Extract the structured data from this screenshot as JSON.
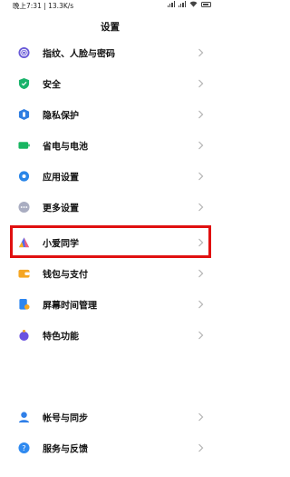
{
  "status_bar": {
    "left_text": "晚上7:31 | 13.3K/s",
    "battery_icon": "battery-icon",
    "wifi_icon": "wifi-icon",
    "signal_icon": "signal-icon"
  },
  "page_title": "设置",
  "groups": [
    {
      "items": [
        {
          "label": "指纹、人脸与密码",
          "icon": "fingerprint-icon",
          "color": "#6a5bd8"
        },
        {
          "label": "安全",
          "icon": "shield-icon",
          "color": "#19b36b"
        },
        {
          "label": "隐私保护",
          "icon": "privacy-icon",
          "color": "#2f7de1"
        },
        {
          "label": "省电与电池",
          "icon": "battery-saver-icon",
          "color": "#18b561"
        },
        {
          "label": "应用设置",
          "icon": "gear-icon",
          "color": "#2a86e8"
        },
        {
          "label": "更多设置",
          "icon": "more-icon",
          "color": "#8c8fa3"
        }
      ]
    },
    {
      "items": [
        {
          "label": "小爱同学",
          "icon": "xiaoai-icon",
          "color": "#4b6cf5"
        },
        {
          "label": "钱包与支付",
          "icon": "wallet-icon",
          "color": "#f5a623"
        },
        {
          "label": "屏幕时间管理",
          "icon": "screen-time-icon",
          "color": "#2e86f0"
        },
        {
          "label": "特色功能",
          "icon": "feature-icon",
          "color": "#6b52e0"
        }
      ]
    },
    {
      "items": [
        {
          "label": "帐号与同步",
          "icon": "account-icon",
          "color": "#2f7fe8"
        },
        {
          "label": "服务与反馈",
          "icon": "feedback-icon",
          "color": "#2f8af0"
        }
      ]
    }
  ],
  "highlight_color": "#e01010"
}
